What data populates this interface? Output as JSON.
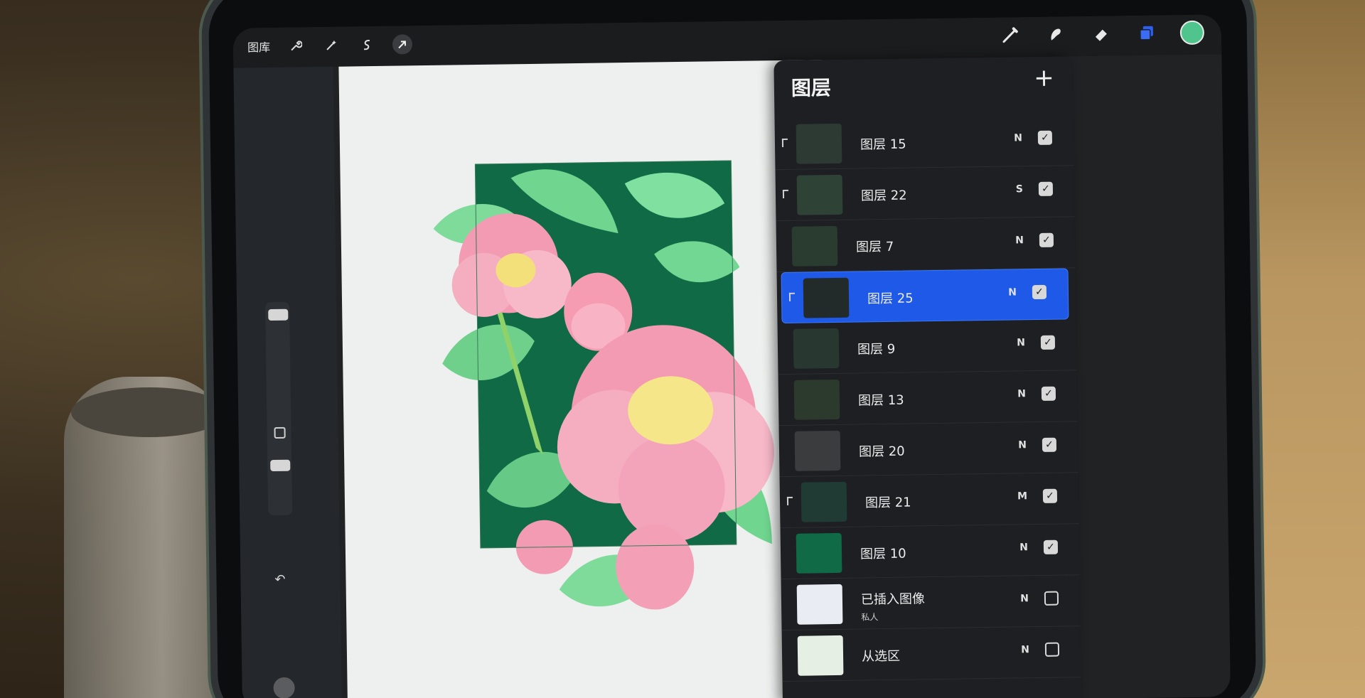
{
  "topbar": {
    "gallery_label": "图库",
    "left_icons": [
      "wrench-icon",
      "magic-wand-icon",
      "selection-icon",
      "transform-arrow-icon"
    ],
    "right_tools": [
      "brush-icon",
      "smudge-icon",
      "eraser-icon",
      "layers-icon"
    ],
    "color": "#4fc48c"
  },
  "layers_panel": {
    "title": "图层",
    "add_label": "+",
    "layers": [
      {
        "name": "图层 15",
        "mode": "N",
        "visible": true,
        "clipped": true,
        "selected": false,
        "sub": ""
      },
      {
        "name": "图层 22",
        "mode": "S",
        "visible": true,
        "clipped": true,
        "selected": false,
        "sub": ""
      },
      {
        "name": "图层 7",
        "mode": "N",
        "visible": true,
        "clipped": false,
        "selected": false,
        "sub": ""
      },
      {
        "name": "图层 25",
        "mode": "N",
        "visible": true,
        "clipped": true,
        "selected": true,
        "sub": ""
      },
      {
        "name": "图层 9",
        "mode": "N",
        "visible": true,
        "clipped": false,
        "selected": false,
        "sub": ""
      },
      {
        "name": "图层 13",
        "mode": "N",
        "visible": true,
        "clipped": false,
        "selected": false,
        "sub": ""
      },
      {
        "name": "图层 20",
        "mode": "N",
        "visible": true,
        "clipped": false,
        "selected": false,
        "sub": ""
      },
      {
        "name": "图层 21",
        "mode": "M",
        "visible": true,
        "clipped": true,
        "selected": false,
        "sub": ""
      },
      {
        "name": "图层 10",
        "mode": "N",
        "visible": true,
        "clipped": false,
        "selected": false,
        "sub": ""
      },
      {
        "name": "已插入图像",
        "mode": "N",
        "visible": false,
        "clipped": false,
        "selected": false,
        "sub": "私人"
      },
      {
        "name": "从选区",
        "mode": "N",
        "visible": false,
        "clipped": false,
        "selected": false,
        "sub": ""
      }
    ]
  },
  "colors": {
    "accent": "#1f59e8",
    "leaf": "#5fd38a",
    "petal": "#f2a0b6",
    "background_green": "#0f6a45"
  }
}
